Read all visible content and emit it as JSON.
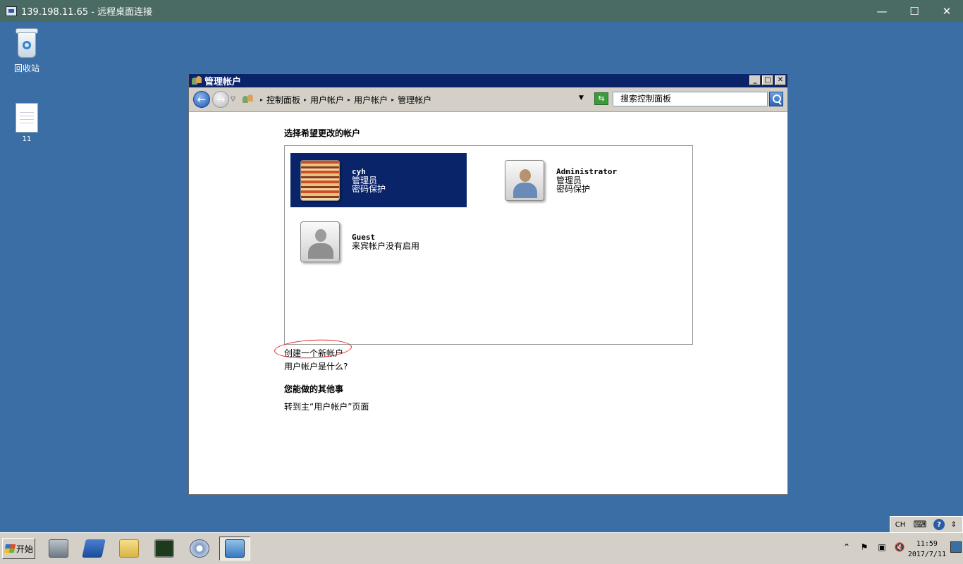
{
  "rdp": {
    "title": "139.198.11.65 - 远程桌面连接",
    "min": "—",
    "max": "☐",
    "close": "✕"
  },
  "desktop": {
    "icons": [
      {
        "label": "回收站",
        "icon": "recycle-bin-icon"
      },
      {
        "label": "11",
        "icon": "text-file-icon"
      }
    ]
  },
  "window": {
    "title": "管理帐户",
    "buttons": {
      "min": "_",
      "max": "□",
      "close": "✕"
    },
    "nav": {
      "back": "←",
      "forward": "→",
      "history": "▽",
      "breadcrumb": [
        "控制面板",
        "用户帐户",
        "用户帐户",
        "管理帐户"
      ],
      "separator": "▸",
      "dropdown": "▼",
      "refresh": "⇆",
      "search_placeholder": "搜索控制面板"
    },
    "content": {
      "heading": "选择希望更改的帐户",
      "accounts": [
        {
          "name": "cyh",
          "role": "管理员",
          "status": "密码保护",
          "selected": true
        },
        {
          "name": "Administrator",
          "role": "管理员",
          "status": "密码保护",
          "selected": false
        },
        {
          "name": "Guest",
          "role": "来宾帐户没有启用",
          "status": "",
          "selected": false
        }
      ],
      "create_link": "创建一个新帐户",
      "what_link": "用户帐户是什么?",
      "other_heading": "您能做的其他事",
      "goto_link": "转到主“用户帐户”页面"
    }
  },
  "taskbar": {
    "start_label": "开始",
    "tray_top": {
      "lang": "CH",
      "keyboard": "⌨",
      "help": "?",
      "more": "⇕"
    },
    "tray_icons": {
      "expand": "⌃",
      "flag": "⚑",
      "network": "▣",
      "volume": "🔇"
    },
    "clock_time": "11:59",
    "clock_date": "2017/7/11"
  }
}
